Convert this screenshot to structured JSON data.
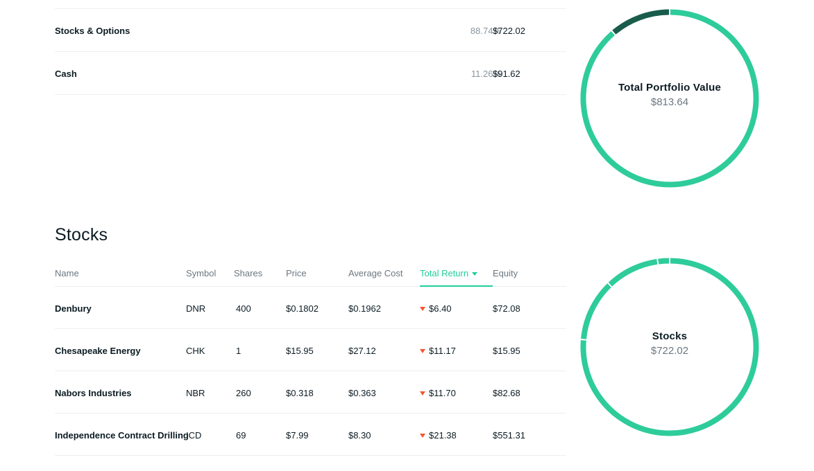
{
  "allocation": {
    "rows": [
      {
        "name": "Stocks & Options",
        "percent": "88.74%",
        "value": "$722.02"
      },
      {
        "name": "Cash",
        "percent": "11.26%",
        "value": "$91.62"
      }
    ]
  },
  "portfolio_donut": {
    "title": "Total Portfolio Value",
    "value": "$813.64"
  },
  "stocks": {
    "title": "Stocks",
    "columns": {
      "name": "Name",
      "symbol": "Symbol",
      "shares": "Shares",
      "price": "Price",
      "avg_cost": "Average Cost",
      "total_return": "Total Return",
      "equity": "Equity"
    },
    "sort_column": "total_return",
    "rows": [
      {
        "name": "Denbury",
        "symbol": "DNR",
        "shares": "400",
        "price": "$0.1802",
        "avg_cost": "$0.1962",
        "total_return": "$6.40",
        "return_direction": "down",
        "equity": "$72.08"
      },
      {
        "name": "Chesapeake Energy",
        "symbol": "CHK",
        "shares": "1",
        "price": "$15.95",
        "avg_cost": "$27.12",
        "total_return": "$11.17",
        "return_direction": "down",
        "equity": "$15.95"
      },
      {
        "name": "Nabors Industries",
        "symbol": "NBR",
        "shares": "260",
        "price": "$0.318",
        "avg_cost": "$0.363",
        "total_return": "$11.70",
        "return_direction": "down",
        "equity": "$82.68"
      },
      {
        "name": "Independence Contract Drilling",
        "symbol": "ICD",
        "shares": "69",
        "price": "$7.99",
        "avg_cost": "$8.30",
        "total_return": "$21.38",
        "return_direction": "down",
        "equity": "$551.31"
      }
    ]
  },
  "stocks_donut": {
    "title": "Stocks",
    "value": "$722.02"
  },
  "colors": {
    "accent_green": "#21ce99",
    "donut_green": "#2ecc9a",
    "donut_dark": "#1a5c4c",
    "negative_red": "#f45531"
  },
  "icons": {
    "sort_indicator": "caret-down-icon",
    "negative_return": "down-triangle-icon"
  }
}
